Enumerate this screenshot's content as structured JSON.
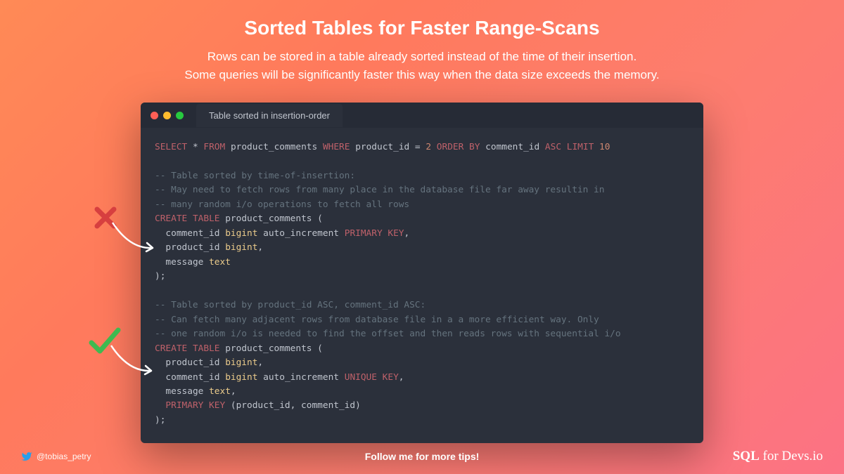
{
  "title": "Sorted Tables for Faster Range-Scans",
  "subtitle_line1": "Rows can be stored in a table already sorted instead of the time of their insertion.",
  "subtitle_line2": "Some queries will be significantly faster this way when the data size exceeds the memory.",
  "editor": {
    "tab": "Table sorted in insertion-order"
  },
  "code": {
    "query": {
      "select": "SELECT",
      "star": "*",
      "from": "FROM",
      "tbl": "product_comments",
      "where": "WHERE",
      "cond": "product_id = ",
      "val": "2",
      "orderby": "ORDER BY",
      "col": "comment_id",
      "asc": "ASC",
      "limit": "LIMIT",
      "n": "10"
    },
    "block1": {
      "c1": "-- Table sorted by time-of-insertion:",
      "c2": "-- May need to fetch rows from many place in the database file far away resultin in",
      "c3": "-- many random i/o operations to fetch all rows",
      "create": "CREATE",
      "table": "TABLE",
      "name": "product_comments (",
      "l1a": "comment_id",
      "l1b": "bigint",
      "l1c": "auto_increment",
      "l1d": "PRIMARY KEY",
      "l2a": "product_id",
      "l2b": "bigint",
      "l3a": "message",
      "l3b": "text",
      "end": ");"
    },
    "block2": {
      "c1": "-- Table sorted by product_id ASC, comment_id ASC:",
      "c2": "-- Can fetch many adjacent rows from database file in a a more efficient way. Only",
      "c3": "-- one random i/o is needed to find the offset and then reads rows with sequential i/o",
      "create": "CREATE",
      "table": "TABLE",
      "name": "product_comments (",
      "l1a": "product_id",
      "l1b": "bigint",
      "l2a": "comment_id",
      "l2b": "bigint",
      "l2c": "auto_increment",
      "l2d": "UNIQUE KEY",
      "l3a": "message",
      "l3b": "text",
      "l4a": "PRIMARY KEY",
      "l4b": "(product_id, comment_id)",
      "end": ");"
    }
  },
  "footer": {
    "handle": "@tobias_petry",
    "follow": "Follow me for more tips!",
    "brand_bold": "SQL",
    "brand_rest": " for Devs.io"
  }
}
